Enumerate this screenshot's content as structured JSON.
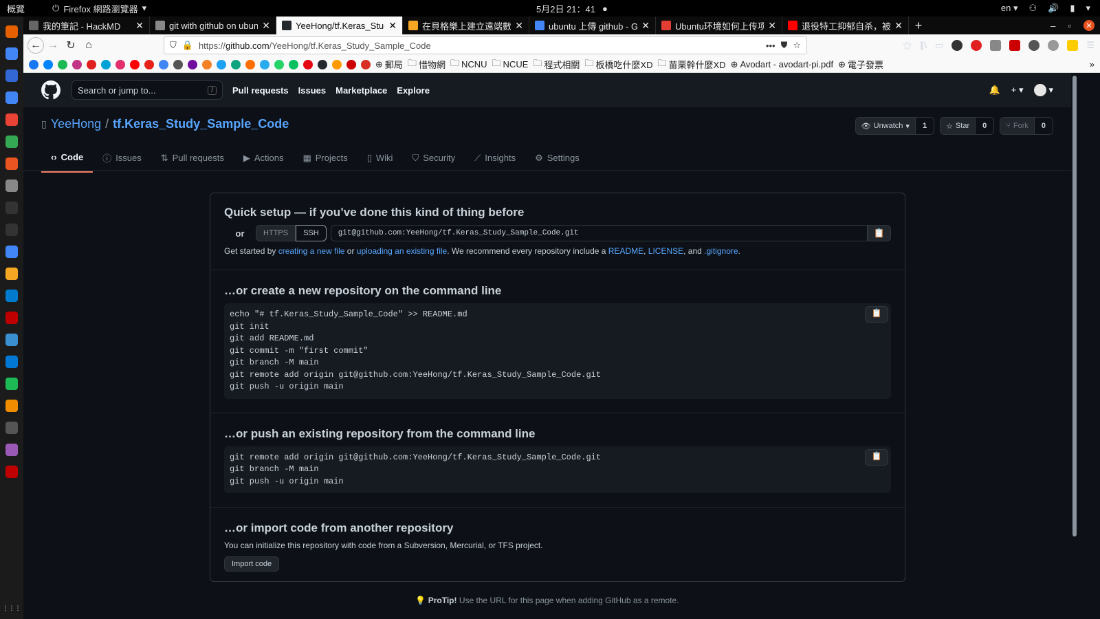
{
  "topbar": {
    "activities": "概覽",
    "app_name": "Firefox 網路瀏覽器",
    "clock": "5月2日 21：41",
    "lang": "en"
  },
  "tabs": [
    {
      "title": "我的筆記 - HackMD",
      "icon": "hackmd-icon",
      "color": "#666"
    },
    {
      "title": "git with github on ubuntu",
      "icon": "doc-icon",
      "color": "#888"
    },
    {
      "title": "YeeHong/tf.Keras_Study",
      "icon": "github-icon",
      "color": "#24292e",
      "active": true
    },
    {
      "title": "在貝格樂上建立遠端數據",
      "icon": "sheet-icon",
      "color": "#f5a623"
    },
    {
      "title": "ubuntu 上傳 github - Goo",
      "icon": "google-icon",
      "color": "#4285f4"
    },
    {
      "title": "Ubuntu环境如何上传项目",
      "icon": "csdn-icon",
      "color": "#e33e33"
    },
    {
      "title": "退役特工抑郁自杀，被",
      "icon": "youtube-icon",
      "color": "#ff0000"
    }
  ],
  "url": {
    "prefix": "https://",
    "host": "github.com",
    "path": "/YeeHong/tf.Keras_Study_Sample_Code"
  },
  "bookmarks": {
    "icons": [
      "#1877f2",
      "#0084ff",
      "#1db954",
      "#c13584",
      "#e02020",
      "#00a1d6",
      "#e1306c",
      "#ff0000",
      "#e62117",
      "#4285f4",
      "#555555",
      "#720e9e",
      "#f48024",
      "#1da1f2",
      "#10a37f",
      "#ff6f00",
      "#2aabee",
      "#25d366",
      "#07c160",
      "#e50914",
      "#24292e",
      "#ff9900",
      "#cc0000",
      "#d93025"
    ],
    "labels": [
      "郵局",
      "惜物網",
      "NCUE",
      "NCUE",
      "程式相關",
      "板橋吃什麼XD",
      "苗栗幹什麼XD",
      "Avodart - avodart-pi.pdf",
      "電子發票"
    ],
    "label_ncnu": "NCNU"
  },
  "gh": {
    "search_placeholder": "Search or jump to...",
    "search_key": "/",
    "nav": [
      "Pull requests",
      "Issues",
      "Marketplace",
      "Explore"
    ]
  },
  "repo": {
    "owner": "YeeHong",
    "separator": "/",
    "name": "tf.Keras_Study_Sample_Code",
    "unwatch_label": "Unwatch",
    "unwatch_count": "1",
    "star_label": "Star",
    "star_count": "0",
    "fork_label": "Fork",
    "fork_count": "0",
    "tabs": [
      "Code",
      "Issues",
      "Pull requests",
      "Actions",
      "Projects",
      "Wiki",
      "Security",
      "Insights",
      "Settings"
    ]
  },
  "quick": {
    "title": "Quick setup — if you’ve done this kind of thing before",
    "or": "or",
    "https": "HTTPS",
    "ssh": "SSH",
    "clone_url": "git@github.com:YeeHong/tf.Keras_Study_Sample_Code.git",
    "desc_start": "Get started by ",
    "link_new_file": "creating a new file",
    "desc_or": " or ",
    "link_upload": "uploading an existing file",
    "desc_mid": ". We recommend every repository include a ",
    "link_readme": "README",
    "comma1": ", ",
    "link_license": "LICENSE",
    "desc_and": ", and ",
    "link_gitignore": ".gitignore",
    "desc_end": "."
  },
  "create": {
    "title": "…or create a new repository on the command line",
    "lines": [
      "echo \"# tf.Keras_Study_Sample_Code\" >> README.md",
      "git init",
      "git add README.md",
      "git commit -m \"first commit\"",
      "git branch -M main",
      "git remote add origin git@github.com:YeeHong/tf.Keras_Study_Sample_Code.git",
      "git push -u origin main"
    ]
  },
  "push": {
    "title": "…or push an existing repository from the command line",
    "lines": [
      "git remote add origin git@github.com:YeeHong/tf.Keras_Study_Sample_Code.git",
      "git branch -M main",
      "git push -u origin main"
    ]
  },
  "import": {
    "title": "…or import code from another repository",
    "desc": "You can initialize this repository with code from a Subversion, Mercurial, or TFS project.",
    "button": "Import code"
  },
  "protip": {
    "bold": "ProTip!",
    "text": " Use the URL for this page when adding GitHub as a remote."
  },
  "dock_colors": [
    "#e66000",
    "#4285f4",
    "#3367d6",
    "#4285f4",
    "#ea4335",
    "#34a853",
    "#e95420",
    "#888888",
    "#333333",
    "#333333",
    "#4285f4",
    "#f5a623",
    "#007acc",
    "#bf0000",
    "#3a8fd1",
    "#0078d4",
    "#1db954",
    "#f08c00",
    "#555555",
    "#9b59b6",
    "#c00000"
  ]
}
